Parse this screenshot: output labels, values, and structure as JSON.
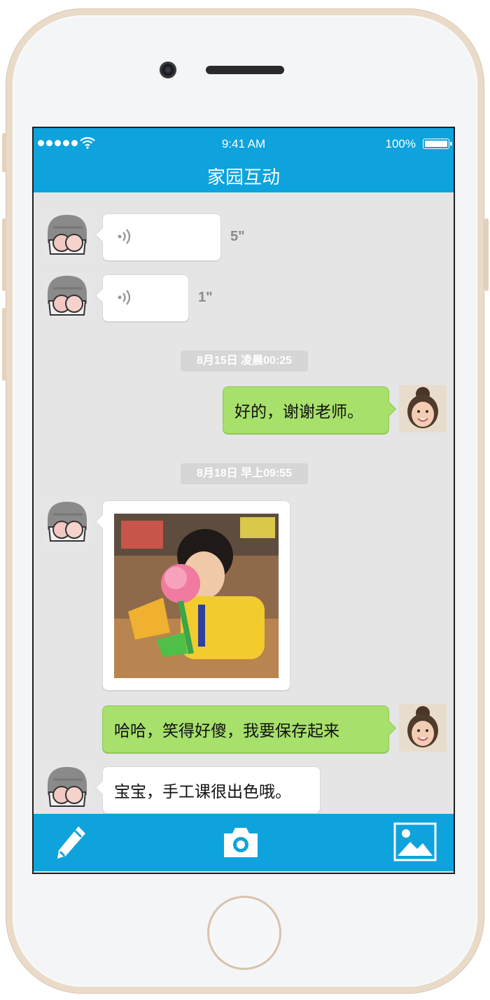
{
  "status_bar": {
    "time": "9:41 AM",
    "battery": "100%"
  },
  "header": {
    "title": "家园互动"
  },
  "messages": [
    {
      "type": "voice",
      "side": "left",
      "duration": "5\""
    },
    {
      "type": "voice",
      "side": "left",
      "duration": "1\""
    },
    {
      "type": "timestamp",
      "text": "8月15日 凌晨00:25"
    },
    {
      "type": "text",
      "side": "right",
      "text": "好的，谢谢老师。"
    },
    {
      "type": "timestamp",
      "text": "8月18日 早上09:55"
    },
    {
      "type": "image",
      "side": "left"
    },
    {
      "type": "text",
      "side": "right",
      "text": "哈哈，笑得好傻，我要保存起来"
    },
    {
      "type": "text",
      "side": "left",
      "text": "宝宝，手工课很出色哦。"
    }
  ],
  "toolbar": {
    "items": [
      {
        "icon": "pencil-icon"
      },
      {
        "icon": "camera-icon"
      },
      {
        "icon": "picture-icon"
      }
    ]
  },
  "colors": {
    "accent": "#0ea3dc",
    "chat_background": "#e5e5e5",
    "sent_bubble": "#a7e06a",
    "received_bubble": "#ffffff"
  }
}
